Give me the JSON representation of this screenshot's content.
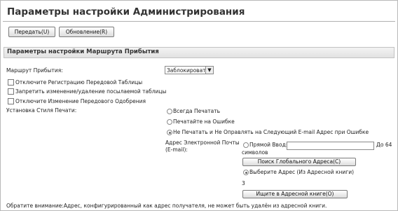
{
  "page": {
    "title": "Параметры настройки Администрирования"
  },
  "toolbar": {
    "submit_label": "Передать(U)",
    "refresh_label": "Обновление(R)"
  },
  "section": {
    "title": "Параметры настройки Маршрута Прибытия"
  },
  "route": {
    "label": "Маршрут Прибытия:",
    "select_value": "Заблокировать",
    "select_arrow": "▼"
  },
  "checkboxes": [
    {
      "label": "Отключите Регистрацию Передовой Таблицы",
      "checked": false
    },
    {
      "label": "Запретить изменение/удаление посылаемой таблицы",
      "checked": false
    },
    {
      "label": "Отключите Изменение Передового Одобрения",
      "checked": false
    }
  ],
  "print_style": {
    "label": "Установка Стиля Печати:",
    "options": [
      {
        "label": "Всегда Печатать",
        "checked": false
      },
      {
        "label": "Печатайте на Ошибке",
        "checked": false
      },
      {
        "label": "Не Печатать и Не Оправлять на Следующий E-mail Адрес при Ошибке",
        "checked": true
      }
    ]
  },
  "email": {
    "label_line1": "Адрес Электронной Почты",
    "label_line2": "(E-mail):",
    "direct_label": "Прямой Ввод:",
    "direct_value": "",
    "limit_prefix": "До 64",
    "limit_suffix": "символов",
    "global_search_button": "Поиск Глобального Адреса(C)",
    "select_address_label": "Выберите Адрес (Из Адресной книги)",
    "address_number": "3",
    "addressbook_search_button": "Ищите в Адресной книге(O)"
  },
  "note": "Обратите внимание:Адрес, конфигурированный как адрес получателя, не может быть удалён из адресной книги."
}
